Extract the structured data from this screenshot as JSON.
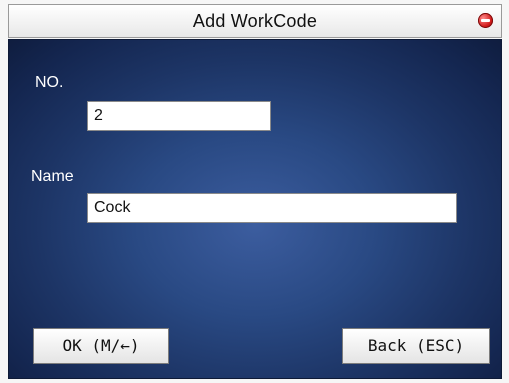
{
  "window": {
    "title": "Add WorkCode",
    "close_icon": "close-icon"
  },
  "form": {
    "no_label": "NO.",
    "no_value": "2",
    "name_label": "Name",
    "name_value": "Cock"
  },
  "buttons": {
    "ok_label": "OK (M/←)",
    "back_label": "Back (ESC)"
  },
  "colors": {
    "panel_accent": "#294983",
    "close_red": "#d11a1a"
  }
}
